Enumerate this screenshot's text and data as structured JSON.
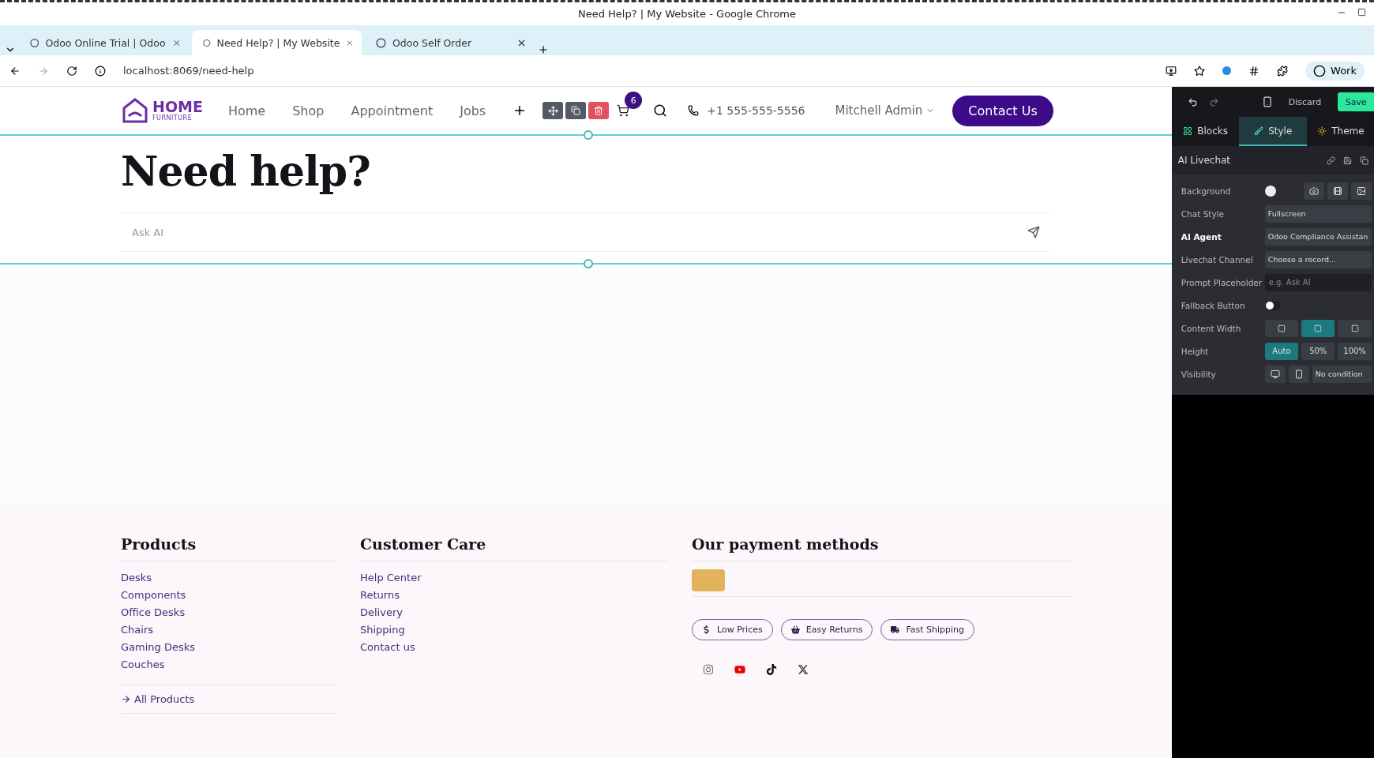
{
  "window": {
    "title": "Need Help? | My Website - Google Chrome"
  },
  "tabs": [
    {
      "label": "Odoo Online Trial | Odoo",
      "selected": false
    },
    {
      "label": "Need Help? | My Website",
      "selected": true
    },
    {
      "label": "Odoo Self Order",
      "selected": false
    }
  ],
  "address_bar": {
    "url": "localhost:8069/need-help"
  },
  "profile": {
    "label": "Work"
  },
  "site_header": {
    "logo": {
      "name": "HOME",
      "subtitle": "FURNITURE"
    },
    "nav": [
      "Home",
      "Shop",
      "Appointment",
      "Jobs"
    ],
    "cart_count": "6",
    "phone": "+1 555-555-5556",
    "user": "Mitchell Admin",
    "cta": "Contact Us"
  },
  "hero": {
    "title": "Need help?",
    "input": {
      "placeholder": "Ask AI"
    }
  },
  "footer": {
    "columns": [
      {
        "title": "Products",
        "links": [
          "Desks",
          "Components",
          "Office Desks",
          "Chairs",
          "Gaming Desks",
          "Couches"
        ],
        "more": "All Products"
      },
      {
        "title": "Customer Care",
        "links": [
          "Help Center",
          "Returns",
          "Delivery",
          "Shipping",
          "Contact us"
        ]
      }
    ],
    "payment": {
      "title": "Our payment methods"
    },
    "badges": [
      {
        "label": "Low Prices",
        "kind": "price"
      },
      {
        "label": "Easy Returns",
        "kind": "basket"
      },
      {
        "label": "Fast Shipping",
        "kind": "truck"
      }
    ]
  },
  "editor_panel": {
    "discard": "Discard",
    "save": "Save",
    "tabs": [
      {
        "label": "Blocks",
        "selected": false,
        "kind": "blocks"
      },
      {
        "label": "Style",
        "selected": true,
        "kind": "style"
      },
      {
        "label": "Theme",
        "selected": false,
        "kind": "theme"
      }
    ],
    "section": "AI Livechat",
    "rows": [
      {
        "label": "Background",
        "kind": "background",
        "highlighted": false
      },
      {
        "label": "Chat Style",
        "kind": "select",
        "value": "Fullscreen",
        "highlighted": false
      },
      {
        "label": "AI Agent",
        "kind": "select",
        "value": "Odoo Compliance Assistan",
        "highlighted": true
      },
      {
        "label": "Livechat Channel",
        "kind": "select",
        "value": "Choose a record...",
        "highlighted": false
      },
      {
        "label": "Prompt Placeholder",
        "kind": "input",
        "placeholder": "e.g. Ask AI",
        "highlighted": false
      },
      {
        "label": "Fallback Button",
        "kind": "toggle",
        "on": false,
        "highlighted": false
      },
      {
        "label": "Content Width",
        "kind": "width",
        "options": [
          {
            "selected": false
          },
          {
            "selected": true
          },
          {
            "selected": false
          }
        ],
        "highlighted": false
      },
      {
        "label": "Height",
        "kind": "buttons",
        "options": [
          {
            "label": "Auto",
            "selected": true
          },
          {
            "label": "50%",
            "selected": false
          },
          {
            "label": "100%",
            "selected": false
          }
        ],
        "highlighted": false
      },
      {
        "label": "Visibility",
        "kind": "visibility",
        "value": "No condition",
        "highlighted": false
      }
    ]
  }
}
